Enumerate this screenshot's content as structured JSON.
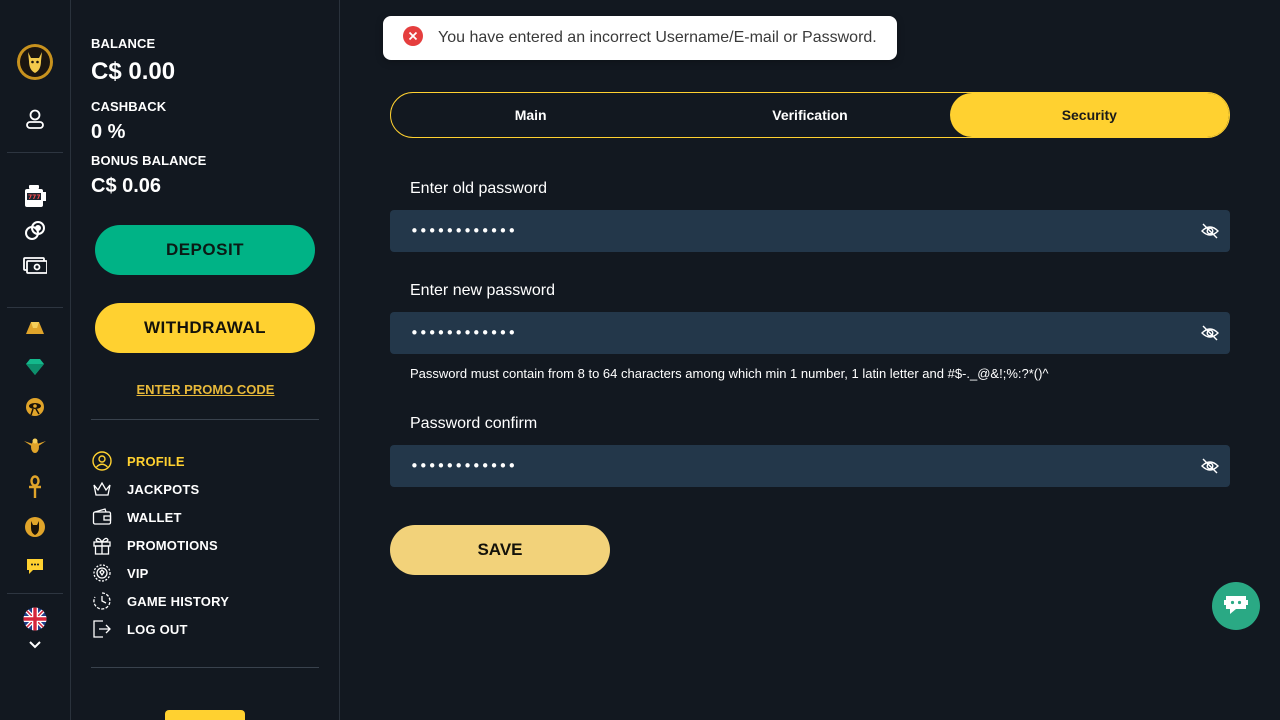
{
  "balance": {
    "balance_label": "BALANCE",
    "balance_value": "C$ 0.00",
    "cashback_label": "CASHBACK",
    "cashback_value": "0 %",
    "bonus_label": "BONUS BALANCE",
    "bonus_value": "C$ 0.06"
  },
  "actions": {
    "deposit_label": "DEPOSIT",
    "withdrawal_label": "WITHDRAWAL",
    "promo_label": "ENTER PROMO CODE"
  },
  "menu": [
    {
      "label": "PROFILE",
      "icon": "profile-icon",
      "active": true
    },
    {
      "label": "JACKPOTS",
      "icon": "crown-icon"
    },
    {
      "label": "WALLET",
      "icon": "wallet-icon"
    },
    {
      "label": "PROMOTIONS",
      "icon": "gift-icon"
    },
    {
      "label": "VIP",
      "icon": "vip-wreath-icon"
    },
    {
      "label": "GAME HISTORY",
      "icon": "history-icon"
    },
    {
      "label": "LOG OUT",
      "icon": "logout-icon"
    }
  ],
  "rail_icons": [
    "logo-cat-icon",
    "user-icon",
    "slot-machine-icon",
    "poker-chips-icon",
    "cash-icon",
    "gold-icon",
    "gem-icon",
    "eye-of-horus-icon",
    "scarab-icon",
    "ankh-icon",
    "cat-icon",
    "chat-bubble-icon",
    "uk-flag-icon",
    "chevron-down-icon"
  ],
  "toast": {
    "message": "You have entered an incorrect Username/E-mail or Password."
  },
  "tabs": [
    {
      "label": "Main"
    },
    {
      "label": "Verification"
    },
    {
      "label": "Security",
      "active": true
    }
  ],
  "form": {
    "old_label": "Enter old password",
    "old_value": "••••••••••••",
    "new_label": "Enter new password",
    "new_value": "••••••••••••",
    "hint": "Password must contain from 8 to 64 characters among which min 1 number, 1 latin letter and #$-._@&!;%:?*()^",
    "confirm_label": "Password confirm",
    "confirm_value": "••••••••••••",
    "save_label": "SAVE"
  },
  "colors": {
    "background": "#121820",
    "accent": "#ffd130",
    "deposit": "#00b386",
    "field": "#23374a",
    "error": "#e53e3e",
    "chat": "#2aa984"
  }
}
